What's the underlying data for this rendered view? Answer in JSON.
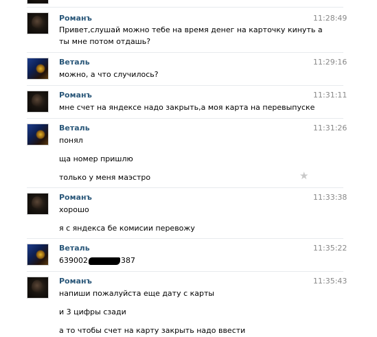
{
  "messages": [
    {
      "author": "Романъ",
      "time": "11:28:49",
      "lines": [
        "Привет,слушай можно тебе на время денег на карточку кинуть а",
        "ты мне потом отдашь?"
      ]
    },
    {
      "author": "Веталь",
      "time": "11:29:16",
      "lines": [
        "можно, а что случилось?"
      ]
    },
    {
      "author": "Романъ",
      "time": "11:31:11",
      "lines": [
        "мне счет на яндексе надо закрыть,а моя карта на перевыпуске"
      ]
    },
    {
      "author": "Веталь",
      "time": "11:31:26",
      "lines": [
        "понял",
        "ща номер пришлю",
        "только у меня маэстро"
      ]
    },
    {
      "author": "Романъ",
      "time": "11:33:38",
      "lines": [
        "хорошо",
        "я с яндекса бе комисии перевожу"
      ]
    },
    {
      "author": "Веталь",
      "time": "11:35:22",
      "number_prefix": "639002",
      "number_suffix": "387"
    },
    {
      "author": "Романъ",
      "time": "11:35:43",
      "lines": [
        "напиши пожалуйста еще дату с карты",
        "и 3 цифры сзади",
        "а то чтобы счет на карту закрыть надо ввести"
      ]
    }
  ],
  "star_icon": "star-icon"
}
